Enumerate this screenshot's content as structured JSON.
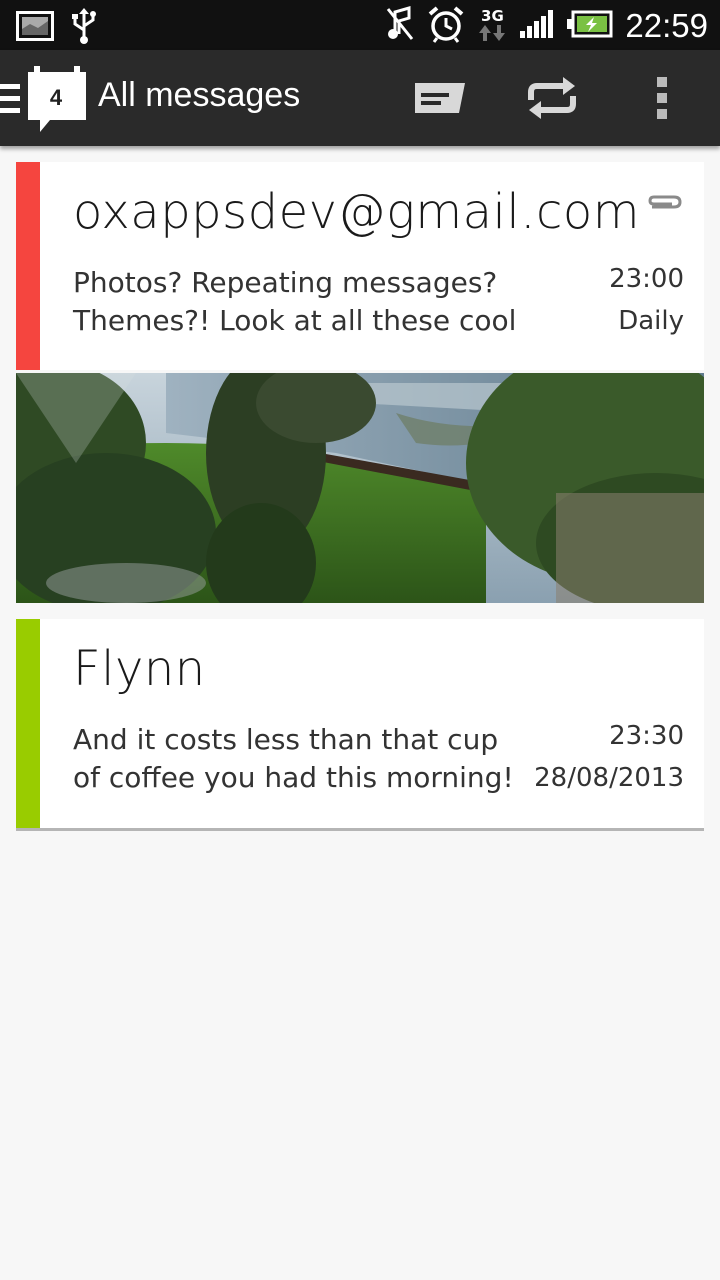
{
  "status_bar": {
    "time": "22:59",
    "network": "3G",
    "icons": [
      "image-notification-icon",
      "usb-icon",
      "mute-icon",
      "alarm-icon",
      "network-3g-icon",
      "signal-icon",
      "battery-charging-icon"
    ]
  },
  "action_bar": {
    "title": "All messages",
    "unread_count": "4",
    "icons": [
      "menu-icon",
      "app-message-icon",
      "compose-message-icon",
      "repeat-icon",
      "overflow-menu-icon"
    ]
  },
  "messages": [
    {
      "sender": "oxappsdev@gmail.com",
      "line1": "Photos? Repeating messages?",
      "line2": "Themes?! Look at all these cool",
      "time": "23:00",
      "schedule": "Daily",
      "has_attachment": true,
      "accent": "#f5453f"
    },
    {
      "sender": "Flynn",
      "line1": "And it costs less than that cup",
      "line2": "of coffee you had this morning!",
      "time": "23:30",
      "schedule": "28/08/2013",
      "has_attachment": false,
      "accent": "#99cc00"
    }
  ],
  "colors": {
    "status_bar": "#111111",
    "action_bar": "#2a2a2a",
    "background": "#f7f7f7"
  }
}
